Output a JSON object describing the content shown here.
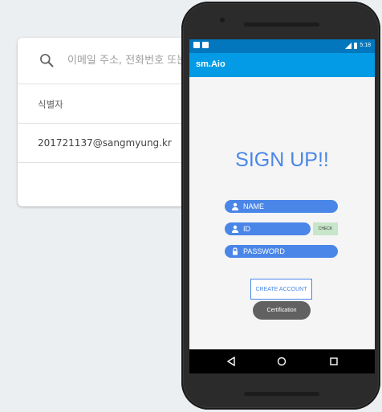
{
  "console": {
    "search": {
      "placeholder": "이메일 주소, 전화번호 또는 사용자 UID로 검색"
    },
    "columns": {
      "identifier": "식별자"
    },
    "users": [
      {
        "identifier": "201721137@sangmyung.kr"
      }
    ]
  },
  "device": {
    "statusbar": {
      "time": "5:18"
    },
    "appbar": {
      "title": "sm.Aio"
    },
    "signup": {
      "title": "SIGN UP!!",
      "name_label": "NAME",
      "id_label": "ID",
      "check_label": "CHECK",
      "password_label": "PASSWORD",
      "create_label": "CREATE ACCOUNT"
    },
    "toast": "Certification"
  },
  "colors": {
    "primary": "#039be5",
    "statusbar": "#0277bd",
    "field": "#4a86e8",
    "check": "#c8e6c9"
  }
}
